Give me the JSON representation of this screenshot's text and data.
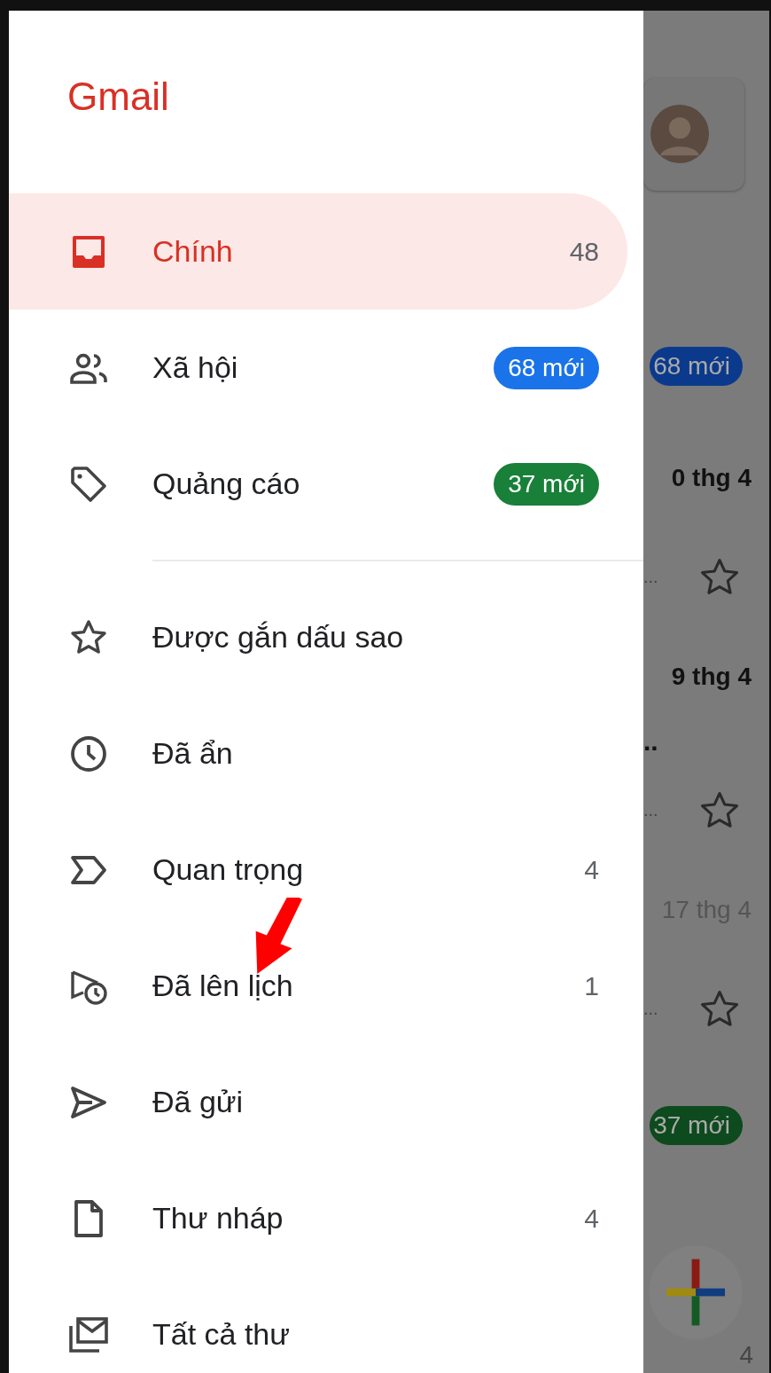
{
  "drawer": {
    "logo": "Gmail",
    "categories": [
      {
        "label": "Chính",
        "count": "48",
        "selected": true
      },
      {
        "label": "Xã hội",
        "badge": {
          "text": "68 mới",
          "color": "#1a73e8"
        },
        "selected": false
      },
      {
        "label": "Quảng cáo",
        "badge": {
          "text": "37 mới",
          "color": "#188038"
        },
        "selected": false
      }
    ],
    "items": [
      {
        "label": "Được gắn dấu sao",
        "selected": false
      },
      {
        "label": "Đã ẩn",
        "selected": false
      },
      {
        "label": "Quan trọng",
        "count": "4",
        "selected": false
      },
      {
        "label": "Đã lên lịch",
        "count": "1",
        "selected": false
      },
      {
        "label": "Đã gửi",
        "selected": false
      },
      {
        "label": "Thư nháp",
        "count": "4",
        "selected": false
      },
      {
        "label": "Tất cả thư",
        "selected": false
      }
    ]
  },
  "background": {
    "rows": [
      {
        "kind": "badge",
        "text": "68 mới",
        "color": "#0b3a8c"
      },
      {
        "kind": "date",
        "text": "0 thg 4",
        "unread": true
      },
      {
        "kind": "star",
        "text": "..."
      },
      {
        "kind": "date",
        "text": "9 thg 4",
        "unread": true
      },
      {
        "kind": "dots",
        "text": ".."
      },
      {
        "kind": "star",
        "text": "..."
      },
      {
        "kind": "date",
        "text": "17 thg 4",
        "unread": false
      },
      {
        "kind": "star",
        "text": "..."
      },
      {
        "kind": "badge",
        "text": "37 mới",
        "color": "#0d4a1e"
      }
    ],
    "fab_count": "4"
  }
}
